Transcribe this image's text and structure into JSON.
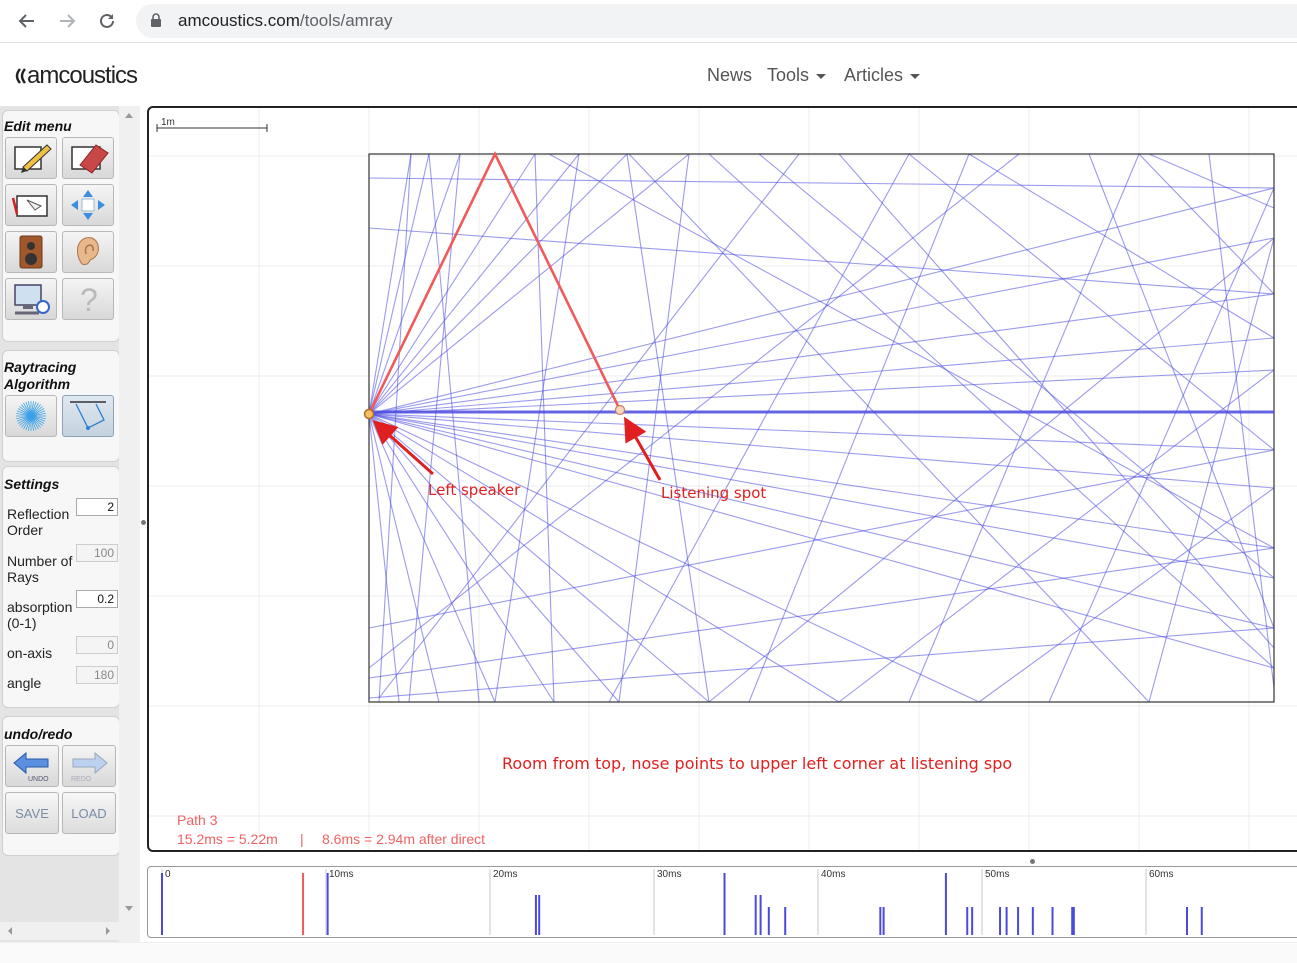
{
  "browser": {
    "url_host": "amcoustics.com",
    "url_path": "/tools/amray"
  },
  "site": {
    "logo_text": "amcoustics",
    "nav": [
      {
        "label": "News",
        "has_menu": false
      },
      {
        "label": "Tools",
        "has_menu": true
      },
      {
        "label": "Articles",
        "has_menu": true
      }
    ]
  },
  "sidebar": {
    "edit_menu": {
      "title": "Edit menu",
      "tools": [
        "pencil-draw-icon",
        "eraser-icon",
        "select-wall-icon",
        "move-arrows-icon",
        "speaker-icon",
        "ear-icon",
        "monitor-settings-icon",
        "help-question-icon"
      ]
    },
    "raytracing": {
      "title_line1": "Raytracing",
      "title_line2": "Algorithm",
      "options": [
        "ray-burst-icon",
        "image-source-icon"
      ],
      "active": 1
    },
    "settings": {
      "title": "Settings",
      "fields": [
        {
          "label_line1": "Reflection",
          "label_line2": "Order",
          "value": "2",
          "enabled": true
        },
        {
          "label_line1": "Number of",
          "label_line2": "Rays",
          "value": "100",
          "enabled": false
        },
        {
          "label_line1": "absorption",
          "label_line2": "(0-1)",
          "value": "0.2",
          "enabled": true
        },
        {
          "label_line1": "on-axis",
          "label_line2": "",
          "value": "0",
          "enabled": false
        },
        {
          "label_line1": "angle",
          "label_line2": "",
          "value": "180",
          "enabled": false
        }
      ]
    },
    "undo_redo": {
      "title": "undo/redo",
      "undo_label": "UNDO",
      "redo_label": "REDO",
      "save_label": "SAVE",
      "load_label": "LOAD"
    }
  },
  "canvas": {
    "scale_label": "1m",
    "annotation_left_speaker": "Left speaker",
    "annotation_listening_spot": "Listening spot",
    "caption": "Room from top, nose points to upper left corner at listening spo",
    "path_title": "Path 3",
    "path_detail_a": "15.2ms = 5.22m",
    "path_separator": "|",
    "path_detail_b": "8.6ms = 2.94m after direct",
    "ray_color": "#4a4ae0",
    "highlight_color": "#f05a5a",
    "annotation_color": "#e02020"
  },
  "timeline": {
    "tick_labels": [
      "0",
      "10ms",
      "20ms",
      "30ms",
      "40ms",
      "50ms",
      "60ms"
    ],
    "impulses_ms": [
      0,
      8.6,
      10.1,
      22.8,
      23.0,
      34.3,
      36.2,
      36.5,
      37.0,
      38.0,
      43.8,
      44.0,
      47.8,
      49.1,
      49.4,
      51.1,
      51.5,
      52.2,
      53.1,
      54.3,
      55.5,
      55.6,
      62.5,
      63.4
    ],
    "highlight_ms": 8.6
  }
}
